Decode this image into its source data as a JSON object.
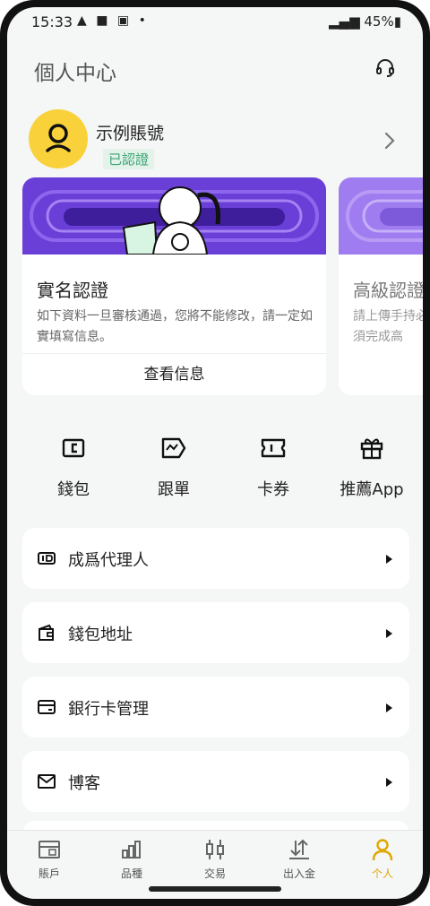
{
  "status_bar": {
    "time": "15:33",
    "battery": "45%"
  },
  "header": {
    "title": "個人中心"
  },
  "profile": {
    "name": "示例賬號",
    "badge": "已認證"
  },
  "cards": [
    {
      "title": "實名認證",
      "description": "如下資料一旦審核通過，您將不能修改，請一定如實填寫信息。",
      "action": "查看信息"
    },
    {
      "title": "高級認證",
      "description": "請上傳手持必須完成高"
    }
  ],
  "quick_actions": [
    {
      "label": "錢包",
      "icon": "wallet-icon"
    },
    {
      "label": "跟單",
      "icon": "copy-trade-icon"
    },
    {
      "label": "卡券",
      "icon": "coupon-icon"
    },
    {
      "label": "推薦App",
      "icon": "gift-icon"
    }
  ],
  "menu": [
    {
      "label": "成爲代理人",
      "icon": "agent-icon"
    },
    {
      "label": "錢包地址",
      "icon": "wallet-address-icon"
    },
    {
      "label": "銀行卡管理",
      "icon": "bank-card-icon"
    },
    {
      "label": "博客",
      "icon": "mail-icon"
    }
  ],
  "tabs": [
    {
      "label": "賬戶",
      "icon": "account-icon"
    },
    {
      "label": "品種",
      "icon": "chart-bars-icon"
    },
    {
      "label": "交易",
      "icon": "candlestick-icon"
    },
    {
      "label": "出入金",
      "icon": "deposit-icon"
    },
    {
      "label": "个人",
      "icon": "person-icon",
      "active": true
    }
  ],
  "colors": {
    "accent": "#f9d23b",
    "active_tab": "#e0a800",
    "banner_purple": "#6a3fd8",
    "verified_green": "#3aa372"
  }
}
